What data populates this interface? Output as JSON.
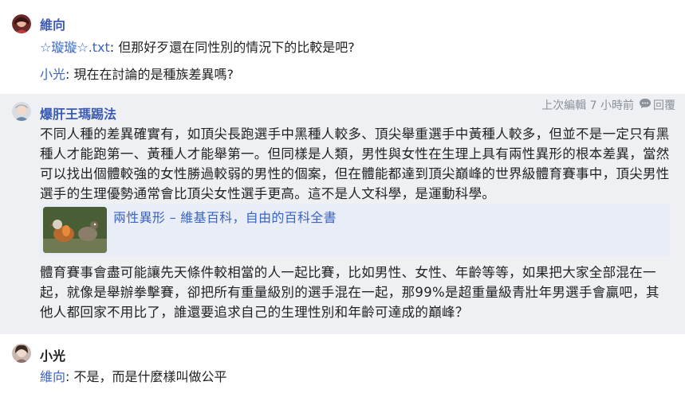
{
  "messages": [
    {
      "author": "維向",
      "lines": [
        {
          "mention": "☆璇璇☆.txt",
          "text": "但那好歹還在同性別的情況下的比較是吧?"
        },
        {
          "mention": "小光",
          "text": "現在在討論的是種族差異嗎?"
        }
      ]
    },
    {
      "author": "爆肝王瑪踢法",
      "edited": "上次編輯 7 小時前",
      "reply_label": "回覆",
      "para1": "不同人種的差異確實有，如頂尖長跑選手中黑種人較多、頂尖舉重選手中黃種人較多，但並不是一定只有黑種人才能跑第一、黃種人才能舉第一。但同樣是人類，男性與女性在生理上具有兩性異形的根本差異，當然可以找出個體較強的女性勝過較弱的男性的個案，但在體能都達到頂尖巔峰的世界級體育賽事中，頂尖男性選手的生理優勢通常會比頂尖女性選手更高。這不是人文科學，是運動科學。",
      "link_title": "兩性異形 – 維基百科，自由的百科全書",
      "para2": "體育賽事會盡可能讓先天條件較相當的人一起比賽，比如男性、女性、年齡等等，如果把大家全部混在一起，就像是舉辦拳擊賽，卻把所有重量級別的選手混在一起，那99%是超重量級青壯年男選手會贏吧，其他人都回家不用比了，誰還要追求自己的生理性別和年齡可達成的巔峰？"
    },
    {
      "author": "小光",
      "lines": [
        {
          "mention": "維向",
          "text": "不是，而是什麼樣叫做公平"
        }
      ]
    }
  ]
}
